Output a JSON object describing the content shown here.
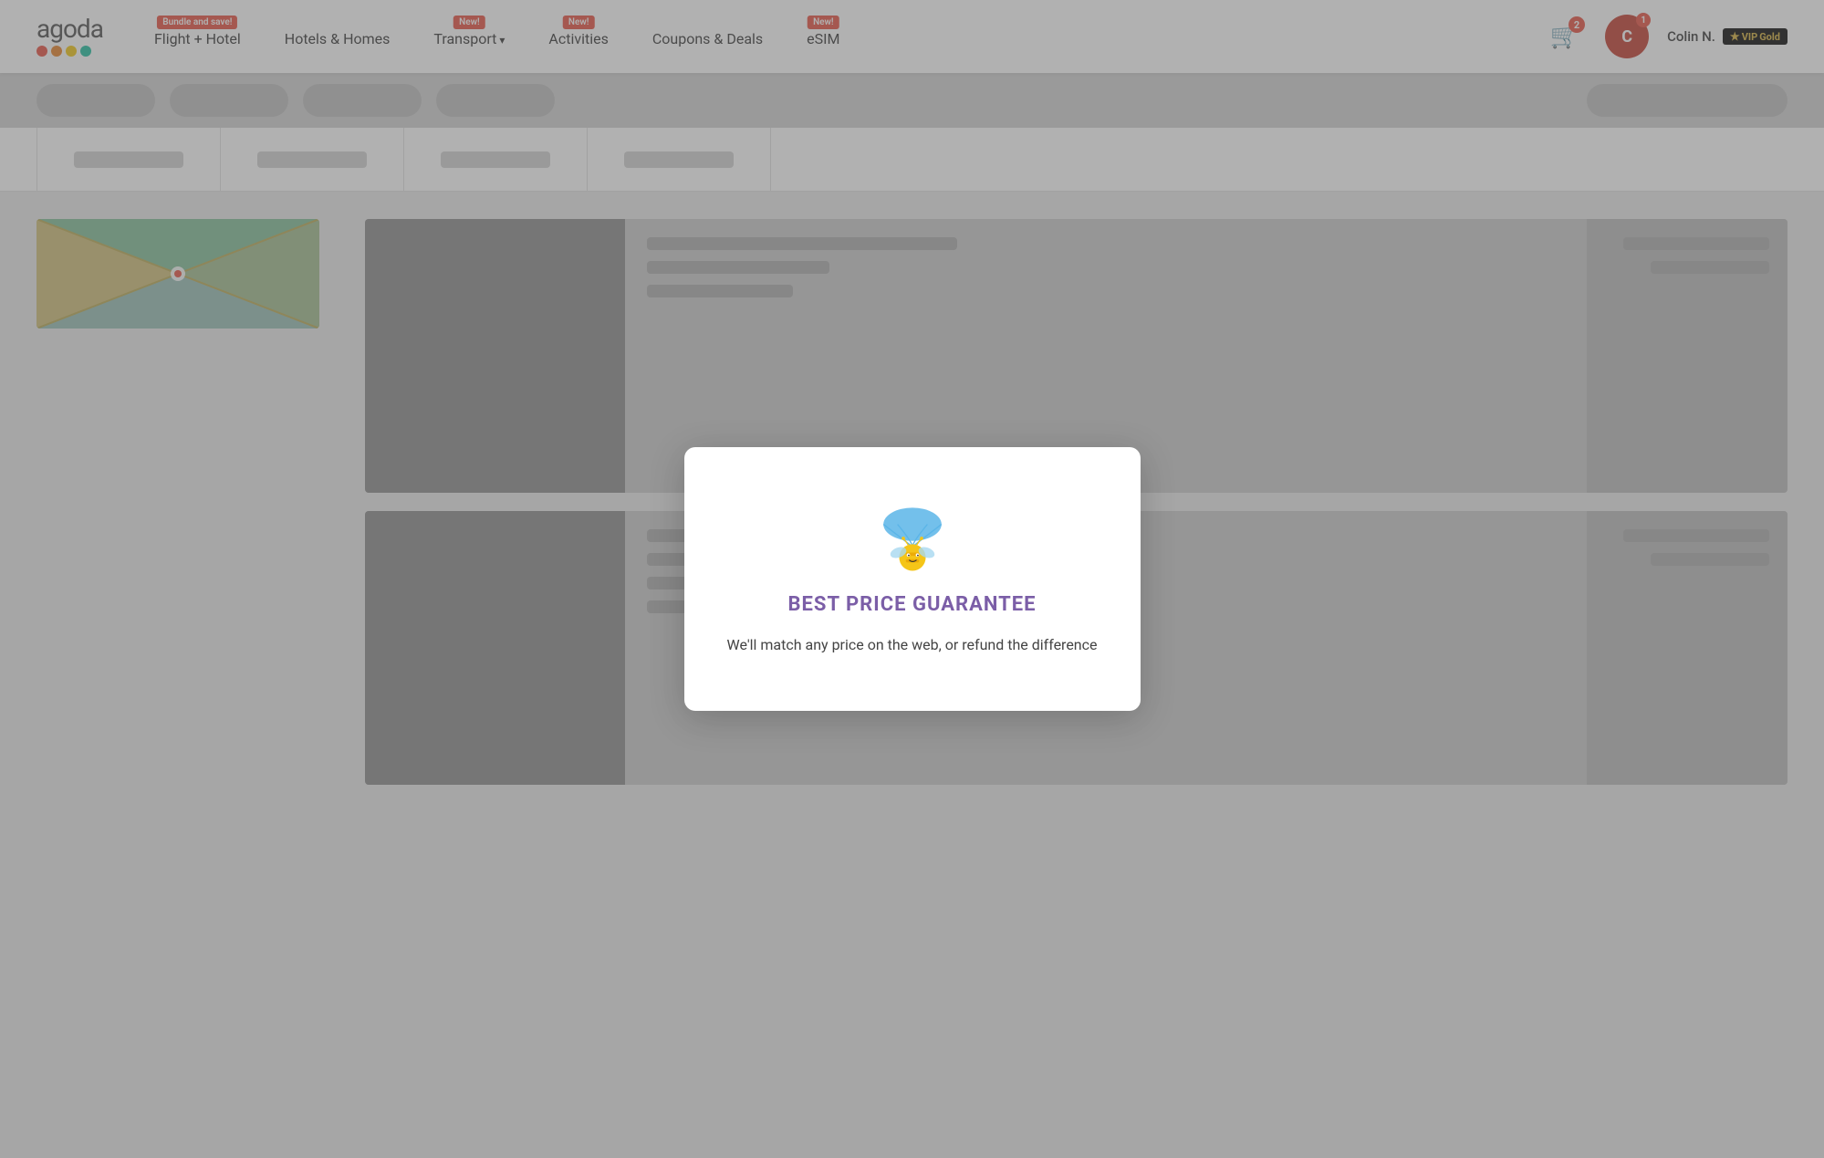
{
  "logo": {
    "text": "agoda",
    "dots": [
      "red",
      "orange",
      "yellow",
      "teal"
    ]
  },
  "nav": {
    "items": [
      {
        "id": "flight-hotel",
        "label": "Flight + Hotel",
        "badge": "Bundle and save!",
        "has_arrow": false
      },
      {
        "id": "hotels-homes",
        "label": "Hotels & Homes",
        "badge": null,
        "has_arrow": false
      },
      {
        "id": "transport",
        "label": "Transport",
        "badge": "New!",
        "has_arrow": true
      },
      {
        "id": "activities",
        "label": "Activities",
        "badge": "New!",
        "has_arrow": false
      },
      {
        "id": "coupons-deals",
        "label": "Coupons & Deals",
        "badge": null,
        "has_arrow": false
      },
      {
        "id": "esim",
        "label": "eSIM",
        "badge": "New!",
        "has_arrow": false
      }
    ],
    "cart": {
      "count": "2"
    },
    "notifications": {
      "count": "1"
    },
    "user": {
      "initial": "C",
      "name": "Colin N.",
      "vip_label": "VIP",
      "tier": "Gold"
    }
  },
  "modal": {
    "title": "BEST PRICE GUARANTEE",
    "subtitle": "We'll match any price on the web, or refund the difference"
  }
}
